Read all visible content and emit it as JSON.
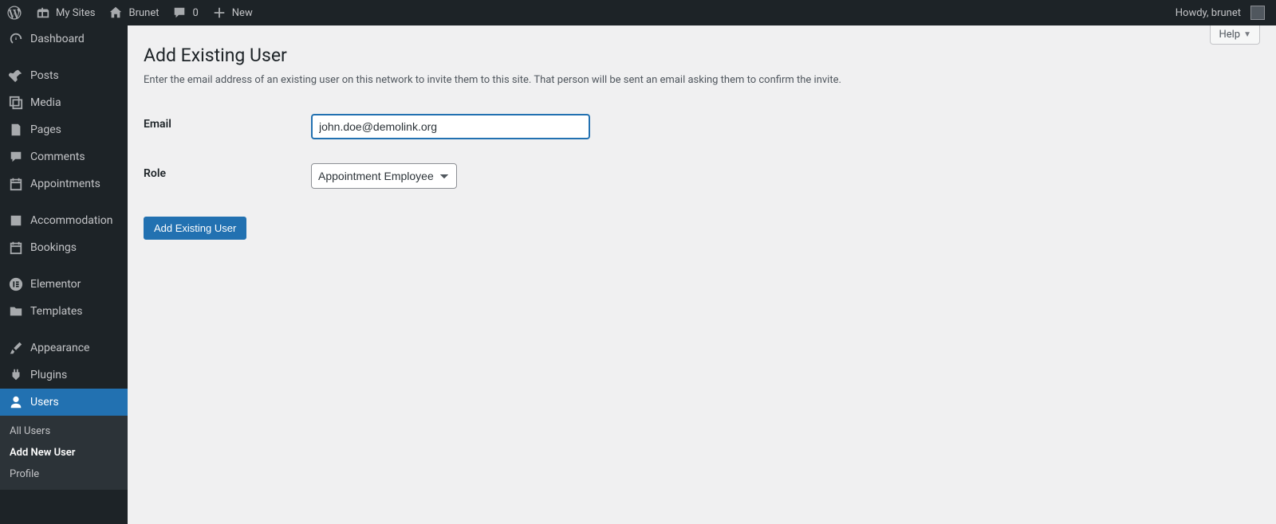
{
  "adminbar": {
    "my_sites": "My Sites",
    "site_name": "Brunet",
    "comments_count": "0",
    "new_label": "New",
    "howdy": "Howdy, brunet"
  },
  "sidebar": {
    "items": [
      {
        "key": "dashboard",
        "label": "Dashboard"
      },
      {
        "key": "posts",
        "label": "Posts"
      },
      {
        "key": "media",
        "label": "Media"
      },
      {
        "key": "pages",
        "label": "Pages"
      },
      {
        "key": "comments",
        "label": "Comments"
      },
      {
        "key": "appointments",
        "label": "Appointments"
      },
      {
        "key": "accommodation",
        "label": "Accommodation"
      },
      {
        "key": "bookings",
        "label": "Bookings"
      },
      {
        "key": "elementor",
        "label": "Elementor"
      },
      {
        "key": "templates",
        "label": "Templates"
      },
      {
        "key": "appearance",
        "label": "Appearance"
      },
      {
        "key": "plugins",
        "label": "Plugins"
      },
      {
        "key": "users",
        "label": "Users"
      }
    ],
    "users_submenu": [
      {
        "key": "all-users",
        "label": "All Users",
        "current": false
      },
      {
        "key": "add-new-user",
        "label": "Add New User",
        "current": true
      },
      {
        "key": "profile",
        "label": "Profile",
        "current": false
      }
    ]
  },
  "page": {
    "help_label": "Help",
    "title": "Add Existing User",
    "description": "Enter the email address of an existing user on this network to invite them to this site. That person will be sent an email asking them to confirm the invite.",
    "email_label": "Email",
    "email_value": "john.doe@demolink.org",
    "role_label": "Role",
    "role_value": "Appointment Employee",
    "submit_label": "Add Existing User"
  }
}
